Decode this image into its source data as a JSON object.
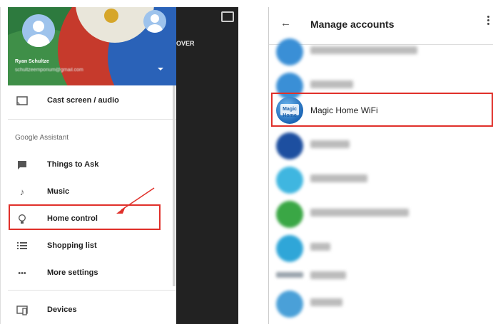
{
  "left_screen": {
    "dark_overlay_partial_label": "OVER",
    "user": {
      "name": "Ryan Schultze",
      "email": "schultzeemporium@gmail.com"
    },
    "menu_top": [
      {
        "icon": "cast-icon",
        "label": "Cast screen / audio"
      }
    ],
    "section_header": "Google Assistant",
    "menu_assistant": [
      {
        "icon": "chat-icon",
        "label": "Things to Ask"
      },
      {
        "icon": "music-note-icon",
        "label": "Music"
      },
      {
        "icon": "lightbulb-icon",
        "label": "Home control"
      },
      {
        "icon": "list-icon",
        "label": "Shopping list"
      },
      {
        "icon": "more-dots-icon",
        "label": "More settings"
      }
    ],
    "menu_bottom": [
      {
        "icon": "devices-icon",
        "label": "Devices"
      }
    ],
    "highlighted_item": "Home control"
  },
  "right_screen": {
    "title": "Manage accounts",
    "accounts": [
      {
        "name": "Lutron Caseta and RA2 Select",
        "blurred": true,
        "color": "#3a8fd6"
      },
      {
        "name": "Lutron Connect",
        "blurred": true,
        "color": "#3a8fd6"
      },
      {
        "name": "Magic Home WiFi",
        "blurred": false,
        "color": "#1d67b6",
        "logo_text": "Magic Home"
      },
      {
        "name": "MobiLinc",
        "blurred": true,
        "color": "#1d4fa0"
      },
      {
        "name": "mydlink home",
        "blurred": true,
        "color": "#3fb6e0"
      },
      {
        "name": "Nanoleaf Smarter Series",
        "blurred": true,
        "color": "#3aa745"
      },
      {
        "name": "Nest",
        "blurred": true,
        "color": "#2fa6d8"
      },
      {
        "name": "Netatmo",
        "blurred": true,
        "color": "#9aa4ad"
      },
      {
        "name": "Nuthyte",
        "blurred": true,
        "color": "#4aa0d8"
      }
    ],
    "highlighted_item": "Magic Home WiFi"
  },
  "colors": {
    "highlight": "#e0302a",
    "drawer_header_green": "#2d7a3e"
  }
}
